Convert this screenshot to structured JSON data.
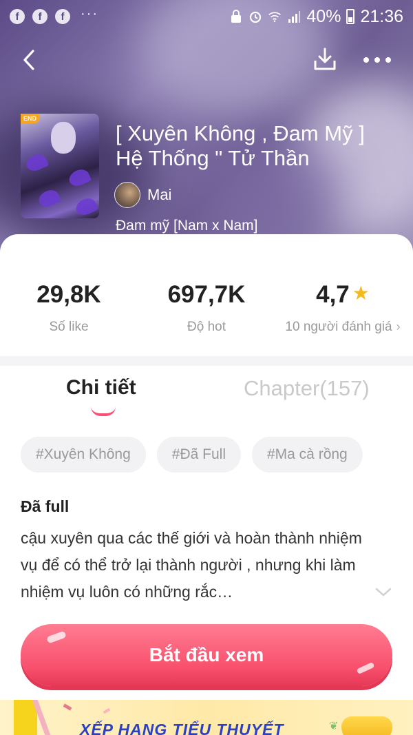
{
  "status_bar": {
    "notifications": [
      "f",
      "f",
      "f"
    ],
    "overflow": "···",
    "battery": "40%",
    "time": "21:36"
  },
  "nav": {
    "back_icon": "chevron-left-icon",
    "download_icon": "download-icon",
    "more_icon": "more-dots-icon"
  },
  "book": {
    "badge": "END",
    "title": "[ Xuyên Không , Đam Mỹ ] Hệ Thống \" Tử Thần",
    "author": "Mai",
    "genre": "Đam mỹ [Nam x Nam]"
  },
  "stats": {
    "likes_value": "29,8K",
    "likes_label": "Số like",
    "hot_value": "697,7K",
    "hot_label": "Độ hot",
    "rating_value": "4,7",
    "rating_label": "10 người đánh giá"
  },
  "tabs": {
    "detail": "Chi tiết",
    "chapter": "Chapter(157)"
  },
  "tags": [
    "#Xuyên Không",
    "#Đã Full",
    "#Ma cà rồng"
  ],
  "description": {
    "heading": "Đã full",
    "text": "cậu xuyên qua các thế giới và hoàn thành nhiệm vụ để có thể trở lại thành người , nhưng khi làm nhiệm vụ luôn có những rắc…"
  },
  "cta": {
    "label": "Bắt đầu xem"
  },
  "banner": {
    "text": "XẾP HẠNG TIỂU THUYẾT"
  },
  "colors": {
    "accent": "#fb4d75",
    "star": "#f4b91b",
    "banner_text": "#2b3fc7"
  }
}
